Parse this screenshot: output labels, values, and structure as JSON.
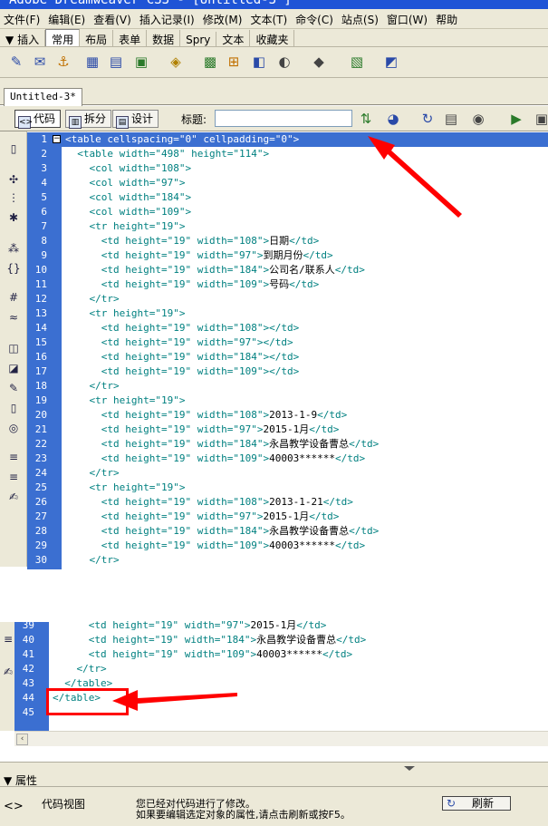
{
  "window": {
    "title": "Adobe Dreamweaver CS3 - [Untitled-3*]"
  },
  "menu": [
    "文件(F)",
    "编辑(E)",
    "查看(V)",
    "插入记录(I)",
    "修改(M)",
    "文本(T)",
    "命令(C)",
    "站点(S)",
    "窗口(W)",
    "帮助"
  ],
  "insert_bar": {
    "toggle": "▼",
    "label": "插入",
    "tabs": [
      "常用",
      "布局",
      "表单",
      "数据",
      "Spry",
      "文本",
      "收藏夹"
    ],
    "selected": "常用"
  },
  "document": {
    "tab": "Untitled-3*",
    "view_buttons": [
      "代码",
      "拆分",
      "设计"
    ],
    "title_label": "标题:",
    "title_value": ""
  },
  "code_lines_top": [
    {
      "n": "1",
      "text": "<table cellspacing=\"0\" cellpadding=\"0\">"
    },
    {
      "n": "2",
      "text": "  <table width=\"498\" height=\"114\">"
    },
    {
      "n": "3",
      "text": "    <col width=\"108\">"
    },
    {
      "n": "4",
      "text": "    <col width=\"97\">"
    },
    {
      "n": "5",
      "text": "    <col width=\"184\">"
    },
    {
      "n": "6",
      "text": "    <col width=\"109\">"
    },
    {
      "n": "7",
      "text": "    <tr height=\"19\">"
    },
    {
      "n": "8",
      "text": "      <td height=\"19\" width=\"108\">",
      "content": "日期",
      "close": "</td>"
    },
    {
      "n": "9",
      "text": "      <td height=\"19\" width=\"97\">",
      "content": "到期月份",
      "close": "</td>"
    },
    {
      "n": "10",
      "text": "      <td height=\"19\" width=\"184\">",
      "content": "公司名/联系人",
      "close": "</td>"
    },
    {
      "n": "11",
      "text": "      <td height=\"19\" width=\"109\">",
      "content": "号码",
      "close": "</td>"
    },
    {
      "n": "12",
      "text": "    </tr>"
    },
    {
      "n": "13",
      "text": "    <tr height=\"19\">"
    },
    {
      "n": "14",
      "text": "      <td height=\"19\" width=\"108\"></td>"
    },
    {
      "n": "15",
      "text": "      <td height=\"19\" width=\"97\"></td>"
    },
    {
      "n": "16",
      "text": "      <td height=\"19\" width=\"184\"></td>"
    },
    {
      "n": "17",
      "text": "      <td height=\"19\" width=\"109\"></td>"
    },
    {
      "n": "18",
      "text": "    </tr>"
    },
    {
      "n": "19",
      "text": "    <tr height=\"19\">"
    },
    {
      "n": "20",
      "text": "      <td height=\"19\" width=\"108\">",
      "content": "2013-1-9",
      "close": "</td>"
    },
    {
      "n": "21",
      "text": "      <td height=\"19\" width=\"97\">",
      "content": "2015-1月",
      "close": "</td>"
    },
    {
      "n": "22",
      "text": "      <td height=\"19\" width=\"184\">",
      "content": "永昌教学设备曹总",
      "close": "</td>"
    },
    {
      "n": "23",
      "text": "      <td height=\"19\" width=\"109\">",
      "content": "40003******",
      "close": "</td>"
    },
    {
      "n": "24",
      "text": "    </tr>"
    },
    {
      "n": "25",
      "text": "    <tr height=\"19\">"
    },
    {
      "n": "26",
      "text": "      <td height=\"19\" width=\"108\">",
      "content": "2013-1-21",
      "close": "</td>"
    },
    {
      "n": "27",
      "text": "      <td height=\"19\" width=\"97\">",
      "content": "2015-1月",
      "close": "</td>"
    },
    {
      "n": "28",
      "text": "      <td height=\"19\" width=\"184\">",
      "content": "永昌教学设备曹总",
      "close": "</td>"
    },
    {
      "n": "29",
      "text": "      <td height=\"19\" width=\"109\">",
      "content": "40003******",
      "close": "</td>"
    },
    {
      "n": "30",
      "text": "    </tr>"
    }
  ],
  "code_lines_bottom": [
    {
      "n": "39",
      "text": "      <td height=\"19\" width=\"97\">",
      "content": "2015-1月",
      "close": "</td>"
    },
    {
      "n": "40",
      "text": "      <td height=\"19\" width=\"184\">",
      "content": "永昌教学设备曹总",
      "close": "</td>"
    },
    {
      "n": "41",
      "text": "      <td height=\"19\" width=\"109\">",
      "content": "40003******",
      "close": "</td>"
    },
    {
      "n": "42",
      "text": "    </tr>"
    },
    {
      "n": "43",
      "text": "  </table>"
    },
    {
      "n": "44",
      "text": "</table>"
    },
    {
      "n": "45",
      "text": ""
    }
  ],
  "properties": {
    "header": "▼ 属性",
    "view_label": "代码视图",
    "message_line1": "您已经对代码进行了修改。",
    "message_line2": "如果要编辑选定对象的属性,请点击刷新或按F5。",
    "refresh_label": "刷新"
  },
  "colors": {
    "gutter": "#3b6fd1",
    "tag": "#008080",
    "annotation": "#ff0000"
  }
}
